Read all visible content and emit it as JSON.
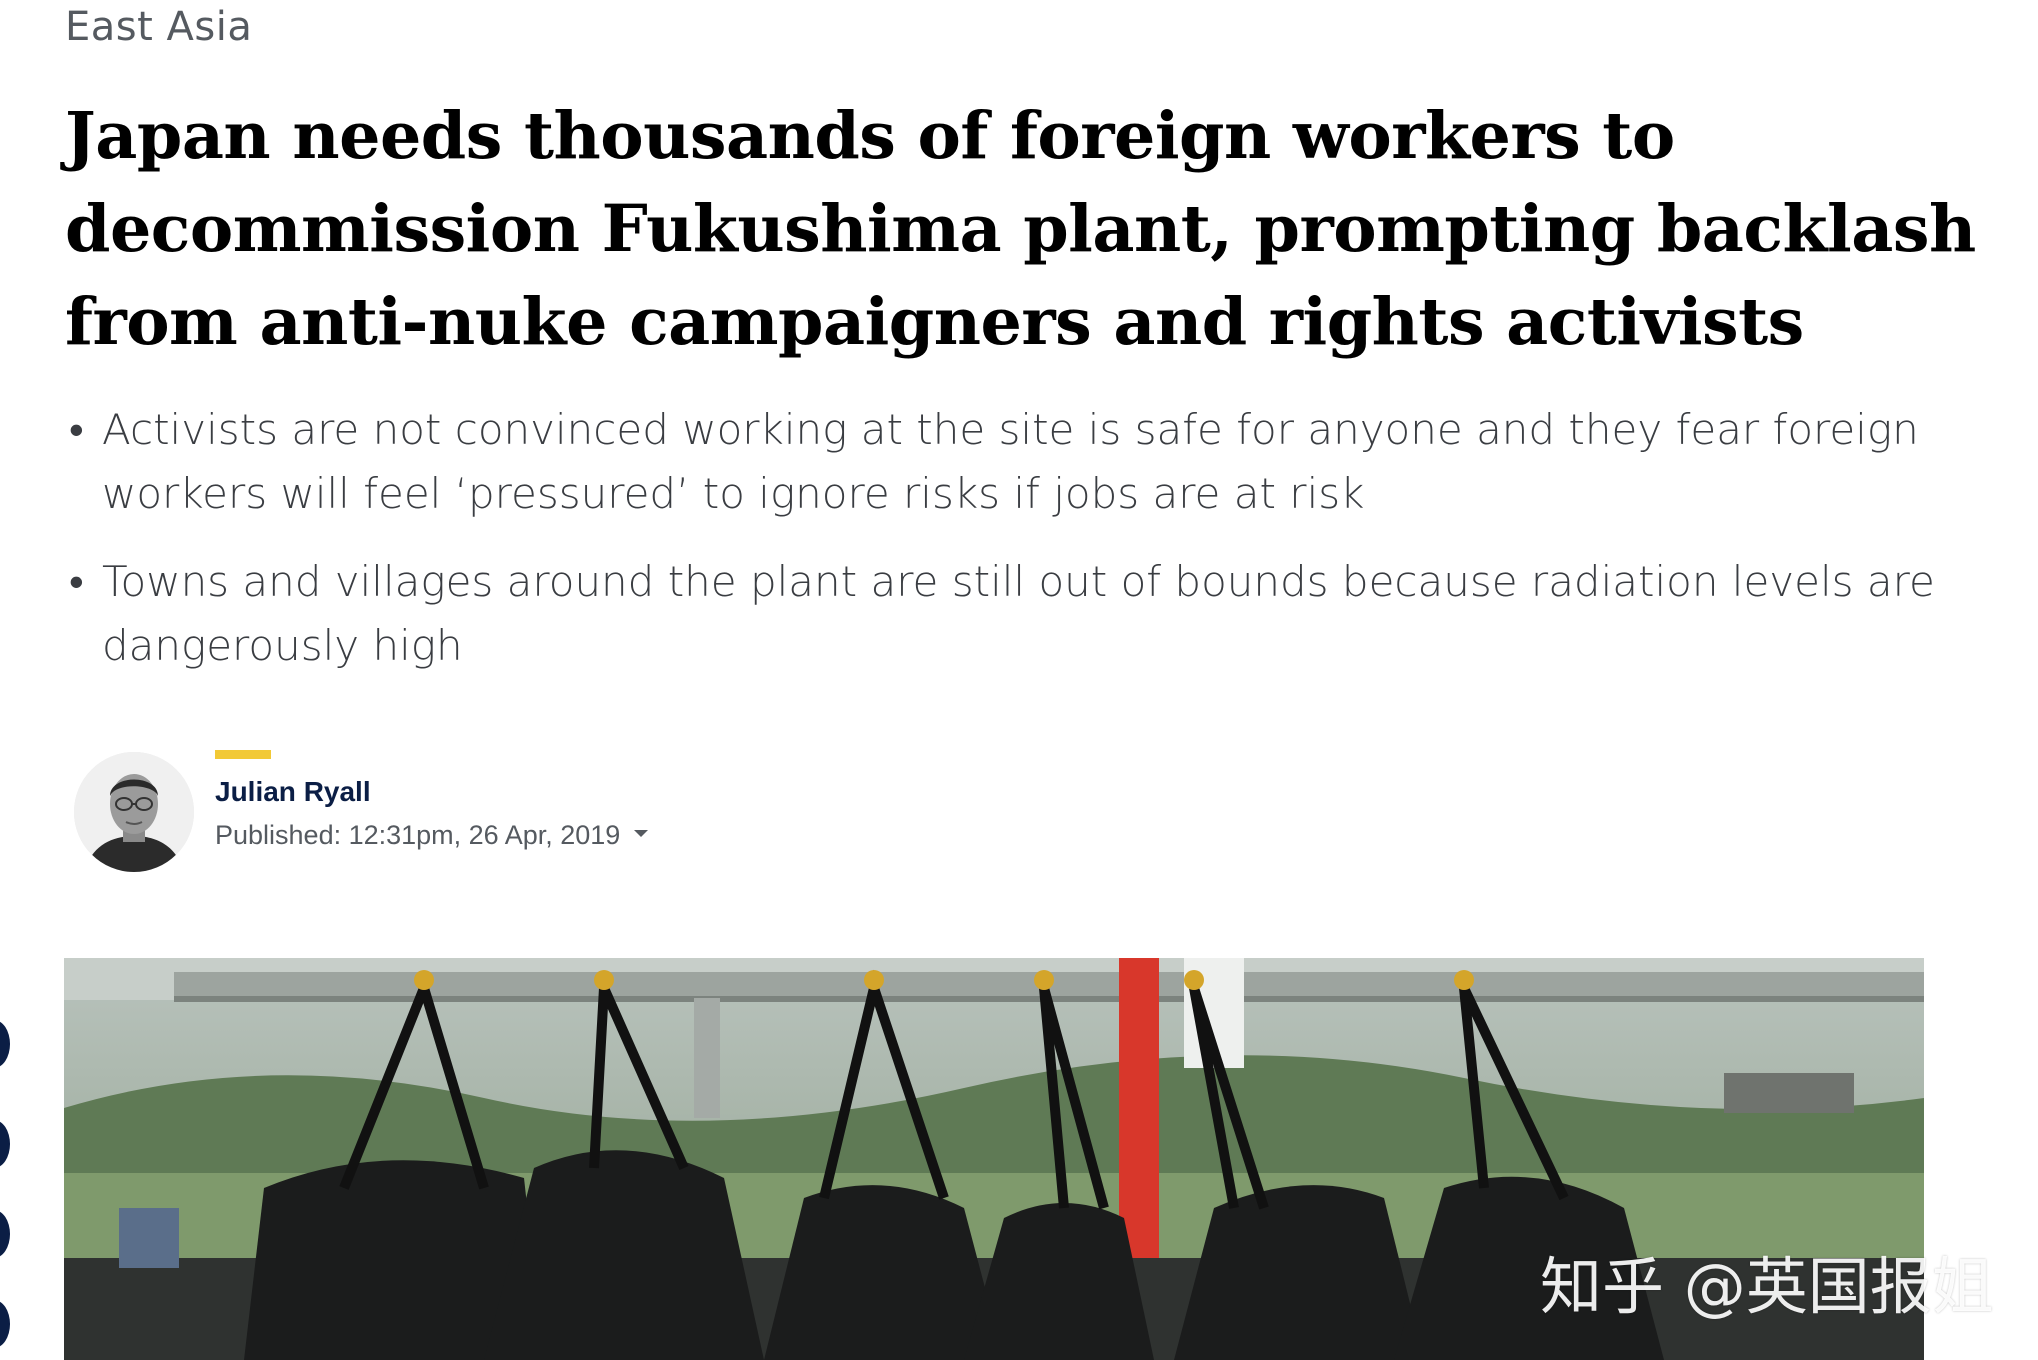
{
  "section": "East Asia",
  "headline": "Japan needs thousands of foreign workers to decommission Fukushima plant, prompting backlash from anti-nuke campaigners and rights activists",
  "summary": [
    "Activists are not convinced working at the site is safe for anyone and they fear foreign workers will feel ‘pressured’ to ignore risks if jobs are at risk",
    "Towns and villages around the plant are still out of bounds because radiation levels are dangerously high"
  ],
  "author": {
    "name": "Julian Ryall",
    "published": "Published: 12:31pm, 26 Apr, 2019"
  },
  "watermark": "知乎 @英国报姐",
  "colors": {
    "accent": "#f2c936",
    "author": "#0b1e45",
    "text": "#3a3d42"
  },
  "icons": {
    "bullet": "•",
    "expand": "chevron-down-icon"
  }
}
